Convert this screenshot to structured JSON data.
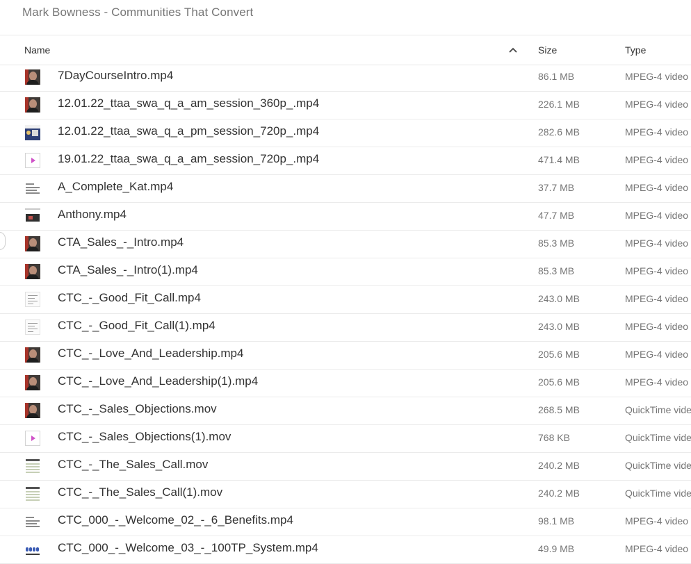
{
  "breadcrumb": {
    "title": "Mark Bowness - Communities That Convert"
  },
  "header": {
    "name_label": "Name",
    "size_label": "Size",
    "type_label": "Type",
    "sort_direction": "ascending",
    "sort_icon": "chevron-up-icon"
  },
  "files": [
    {
      "name": "7DayCourseIntro.mp4",
      "size": "86.1 MB",
      "type": "MPEG-4 video",
      "thumb": "face"
    },
    {
      "name": "12.01.22_ttaa_swa_q_a_am_session_360p_.mp4",
      "size": "226.1 MB",
      "type": "MPEG-4 video",
      "thumb": "face"
    },
    {
      "name": "12.01.22_ttaa_swa_q_a_pm_session_720p_.mp4",
      "size": "282.6 MB",
      "type": "MPEG-4 video",
      "thumb": "slide"
    },
    {
      "name": "19.01.22_ttaa_swa_q_a_am_session_720p_.mp4",
      "size": "471.4 MB",
      "type": "MPEG-4 video",
      "thumb": "video"
    },
    {
      "name": "A_Complete_Kat.mp4",
      "size": "37.7 MB",
      "type": "MPEG-4 video",
      "thumb": "text"
    },
    {
      "name": "Anthony.mp4",
      "size": "47.7 MB",
      "type": "MPEG-4 video",
      "thumb": "strip"
    },
    {
      "name": "CTA_Sales_-_Intro.mp4",
      "size": "85.3 MB",
      "type": "MPEG-4 video",
      "thumb": "face"
    },
    {
      "name": "CTA_Sales_-_Intro(1).mp4",
      "size": "85.3 MB",
      "type": "MPEG-4 video",
      "thumb": "face"
    },
    {
      "name": "CTC_-_Good_Fit_Call.mp4",
      "size": "243.0 MB",
      "type": "MPEG-4 video",
      "thumb": "doc"
    },
    {
      "name": "CTC_-_Good_Fit_Call(1).mp4",
      "size": "243.0 MB",
      "type": "MPEG-4 video",
      "thumb": "doc"
    },
    {
      "name": "CTC_-_Love_And_Leadership.mp4",
      "size": "205.6 MB",
      "type": "MPEG-4 video",
      "thumb": "face"
    },
    {
      "name": "CTC_-_Love_And_Leadership(1).mp4",
      "size": "205.6 MB",
      "type": "MPEG-4 video",
      "thumb": "face"
    },
    {
      "name": "CTC_-_Sales_Objections.mov",
      "size": "268.5 MB",
      "type": "QuickTime video",
      "thumb": "face"
    },
    {
      "name": "CTC_-_Sales_Objections(1).mov",
      "size": "768 KB",
      "type": "QuickTime video",
      "thumb": "video"
    },
    {
      "name": "CTC_-_The_Sales_Call.mov",
      "size": "240.2 MB",
      "type": "QuickTime video",
      "thumb": "sheet"
    },
    {
      "name": "CTC_-_The_Sales_Call(1).mov",
      "size": "240.2 MB",
      "type": "QuickTime video",
      "thumb": "sheet"
    },
    {
      "name": "CTC_000_-_Welcome_02_-_6_Benefits.mp4",
      "size": "98.1 MB",
      "type": "MPEG-4 video",
      "thumb": "text"
    },
    {
      "name": "CTC_000_-_Welcome_03_-_100TP_System.mp4",
      "size": "49.9 MB",
      "type": "MPEG-4 video",
      "thumb": "icons"
    }
  ]
}
